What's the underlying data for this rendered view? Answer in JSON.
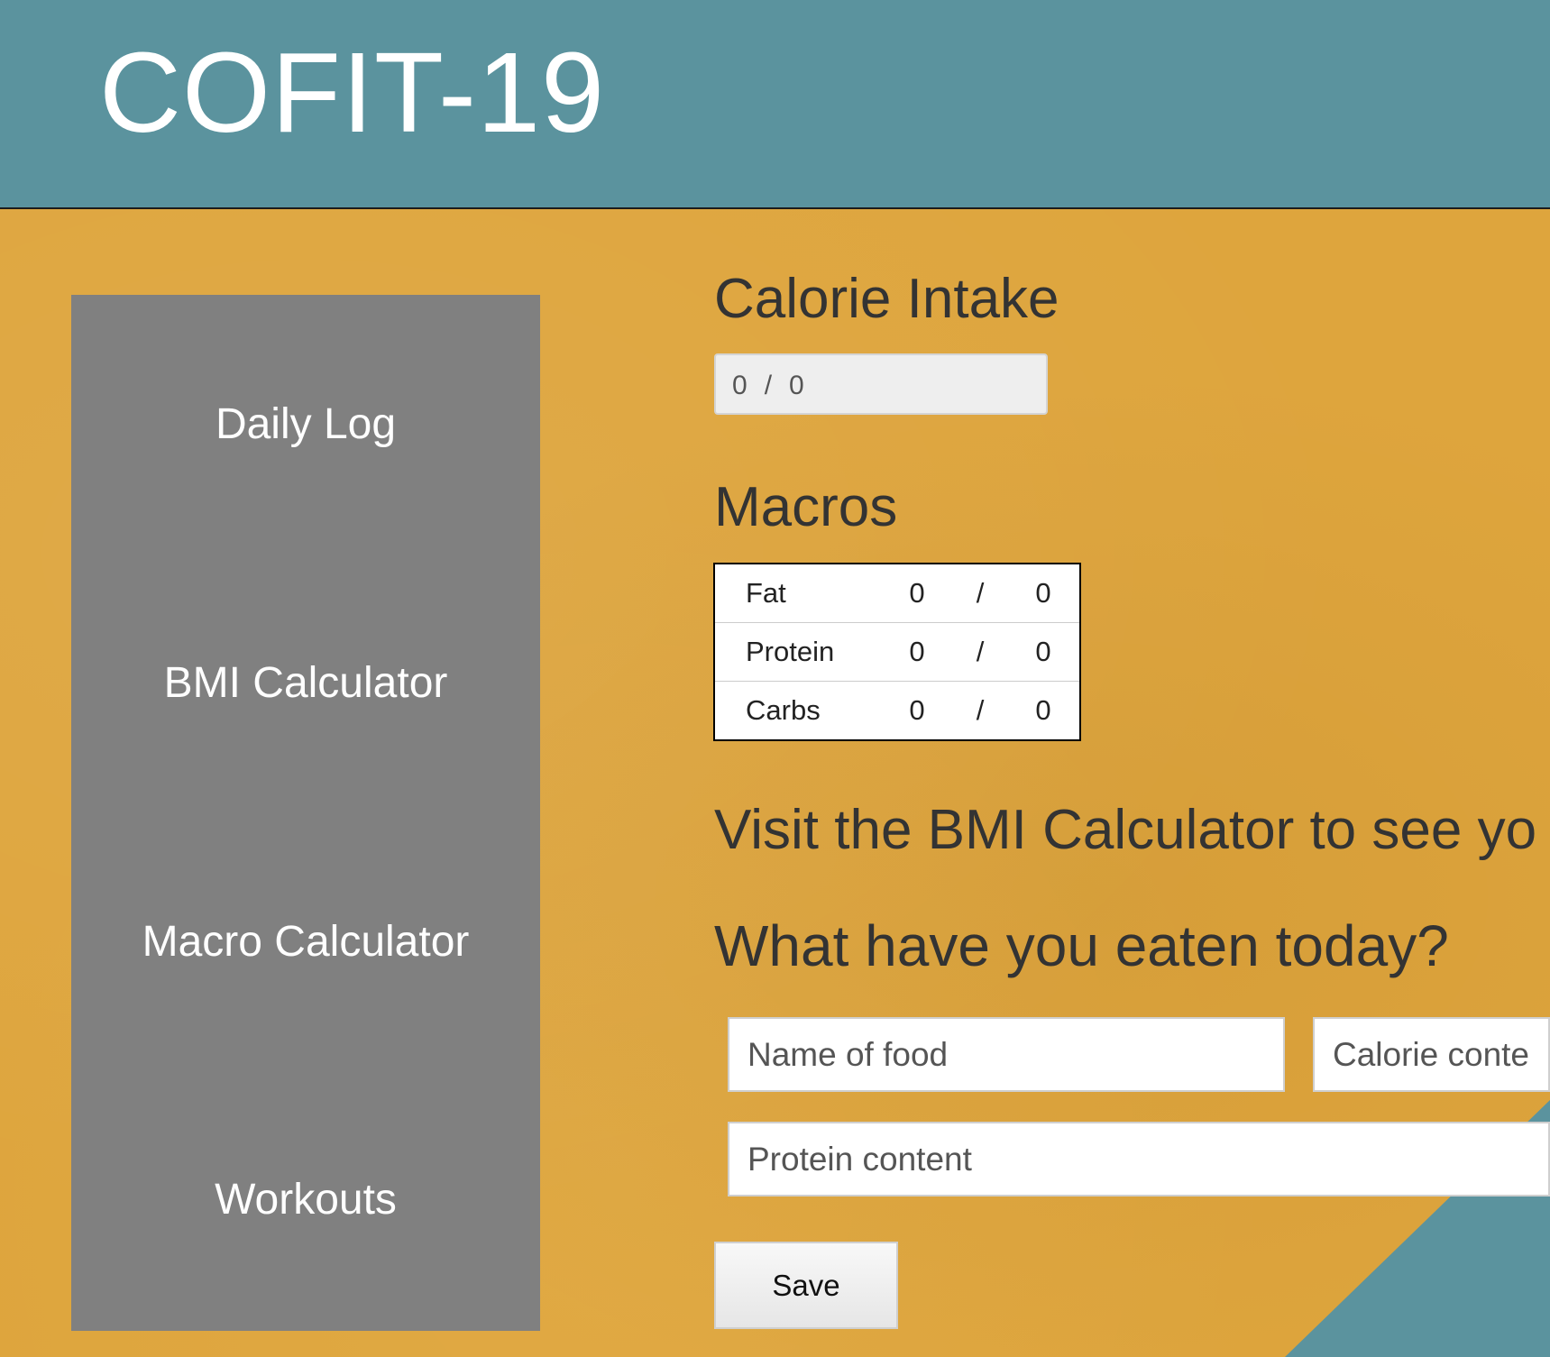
{
  "header": {
    "title": "COFIT-19"
  },
  "sidebar": {
    "items": [
      {
        "label": "Daily Log"
      },
      {
        "label": "BMI Calculator"
      },
      {
        "label": "Macro Calculator"
      },
      {
        "label": "Workouts"
      }
    ]
  },
  "calorie_intake": {
    "heading": "Calorie Intake",
    "consumed": "0",
    "separator": "/",
    "goal": "0"
  },
  "macros": {
    "heading": "Macros",
    "rows": [
      {
        "name": "Fat",
        "value": "0",
        "separator": "/",
        "goal": "0"
      },
      {
        "name": "Protein",
        "value": "0",
        "separator": "/",
        "goal": "0"
      },
      {
        "name": "Carbs",
        "value": "0",
        "separator": "/",
        "goal": "0"
      }
    ]
  },
  "bmi_message": "Visit the BMI Calculator to see yo",
  "food_form": {
    "heading": "What have you eaten today?",
    "name_placeholder": "Name of food",
    "calorie_placeholder": "Calorie conten",
    "protein_placeholder": "Protein content",
    "save_label": "Save"
  },
  "colors": {
    "header_bg": "#5b939e",
    "page_bg": "#dea53d",
    "sidebar_bg": "#808080",
    "accent_teal": "#5b939e"
  }
}
